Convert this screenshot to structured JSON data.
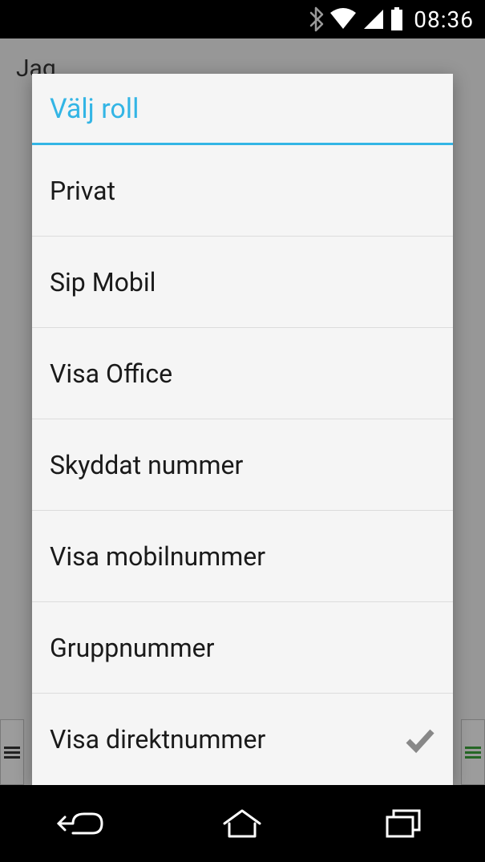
{
  "status": {
    "time": "08:36"
  },
  "bg": {
    "title": "Jag"
  },
  "dialog": {
    "title": "Välj roll",
    "items": [
      {
        "label": "Privat",
        "selected": false
      },
      {
        "label": "Sip Mobil",
        "selected": false
      },
      {
        "label": "Visa Office",
        "selected": false
      },
      {
        "label": "Skyddat nummer",
        "selected": false
      },
      {
        "label": "Visa mobilnummer",
        "selected": false
      },
      {
        "label": "Gruppnummer",
        "selected": false
      },
      {
        "label": "Visa direktnummer",
        "selected": true
      }
    ]
  }
}
